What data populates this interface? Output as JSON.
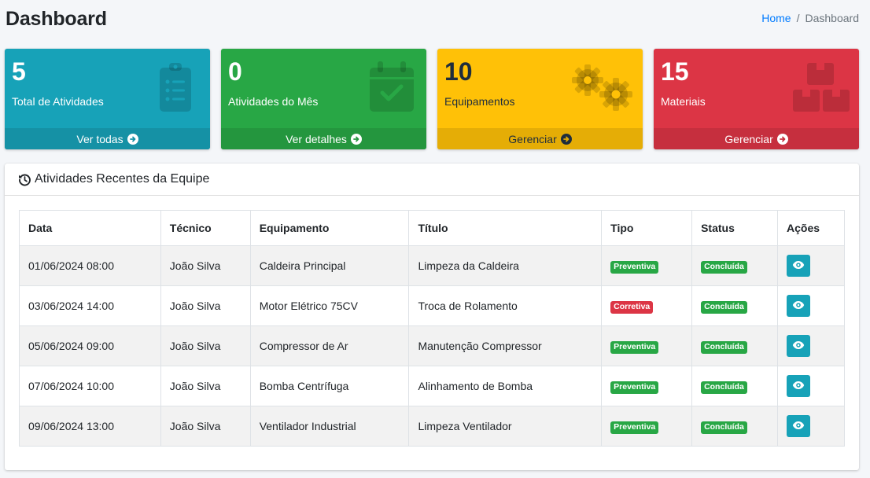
{
  "header": {
    "title": "Dashboard",
    "breadcrumb": {
      "home": "Home",
      "separator": "/",
      "current": "Dashboard"
    }
  },
  "boxes": [
    {
      "value": "5",
      "label": "Total de Atividades",
      "link": "Ver todas",
      "color": "#17a2b8",
      "icon": "clipboard-list-icon"
    },
    {
      "value": "0",
      "label": "Atividades do Mês",
      "link": "Ver detalhes",
      "color": "#28a745",
      "icon": "calendar-check-icon"
    },
    {
      "value": "10",
      "label": "Equipamentos",
      "link": "Gerenciar",
      "color": "#ffc107",
      "icon": "gears-icon"
    },
    {
      "value": "15",
      "label": "Materiais",
      "link": "Gerenciar",
      "color": "#dc3545",
      "icon": "boxes-icon"
    }
  ],
  "recent": {
    "title": "Atividades Recentes da Equipe",
    "columns": [
      "Data",
      "Técnico",
      "Equipamento",
      "Título",
      "Tipo",
      "Status",
      "Ações"
    ],
    "rows": [
      {
        "data": "01/06/2024 08:00",
        "tecnico": "João Silva",
        "equipamento": "Caldeira Principal",
        "titulo": "Limpeza da Caldeira",
        "tipo": "Preventiva",
        "status": "Concluída"
      },
      {
        "data": "03/06/2024 14:00",
        "tecnico": "João Silva",
        "equipamento": "Motor Elétrico 75CV",
        "titulo": "Troca de Rolamento",
        "tipo": "Corretiva",
        "status": "Concluída"
      },
      {
        "data": "05/06/2024 09:00",
        "tecnico": "João Silva",
        "equipamento": "Compressor de Ar",
        "titulo": "Manutenção Compressor",
        "tipo": "Preventiva",
        "status": "Concluída"
      },
      {
        "data": "07/06/2024 10:00",
        "tecnico": "João Silva",
        "equipamento": "Bomba Centrífuga",
        "titulo": "Alinhamento de Bomba",
        "tipo": "Preventiva",
        "status": "Concluída"
      },
      {
        "data": "09/06/2024 13:00",
        "tecnico": "João Silva",
        "equipamento": "Ventilador Industrial",
        "titulo": "Limpeza Ventilador",
        "tipo": "Preventiva",
        "status": "Concluída"
      }
    ]
  },
  "colors": {
    "preventiva": "#28a745",
    "corretiva": "#dc3545",
    "concluida": "#28a745",
    "action": "#17a2b8"
  }
}
